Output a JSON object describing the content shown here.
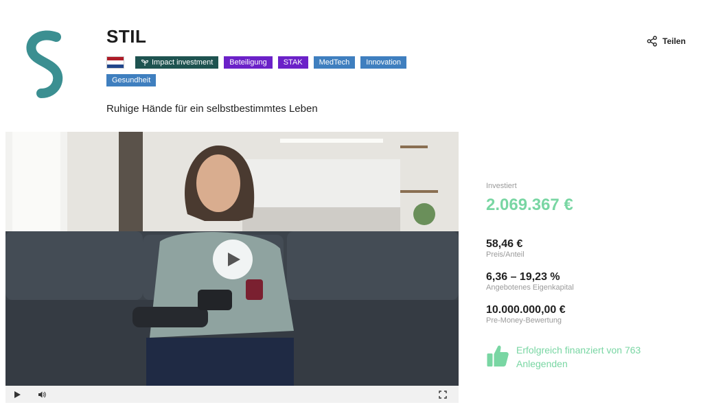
{
  "company": {
    "name": "STIL",
    "tagline": "Ruhige Hände für ein selbstbestimmtes Leben",
    "brand_color": "#3b8f91"
  },
  "share": {
    "label": "Teilen",
    "icon": "share-icon"
  },
  "tags": [
    {
      "label": "Impact investment",
      "icon": "sprout-icon",
      "color": "#1e5350"
    },
    {
      "label": "Beteiligung",
      "color": "#6b21c8"
    },
    {
      "label": "STAK",
      "color": "#6b21c8"
    },
    {
      "label": "MedTech",
      "color": "#3f7fbf"
    },
    {
      "label": "Innovation",
      "color": "#3f7fbf"
    },
    {
      "label": "Gesundheit",
      "color": "#3f7fbf"
    }
  ],
  "country_flag": {
    "name": "netherlands-flag",
    "colors": [
      "#ae1c28",
      "#ffffff",
      "#21468b"
    ]
  },
  "video": {
    "play_icon": "play-icon",
    "controls": [
      "play-icon",
      "volume-icon",
      "fullscreen-icon"
    ]
  },
  "stats": {
    "invested_label": "Investiert",
    "invested_value": "2.069.367 €",
    "price_value": "58,46 €",
    "price_label": "Preis/Anteil",
    "equity_value": "6,36 – 19,23 %",
    "equity_label": "Angebotenes Eigenkapital",
    "valuation_value": "10.000.000,00 €",
    "valuation_label": "Pre-Money-Bewertung",
    "accent_color": "#79d6a3"
  },
  "funded": {
    "text": "Erfolgreich finanziert von 763 Anlegenden",
    "icon": "thumbs-up-icon"
  }
}
